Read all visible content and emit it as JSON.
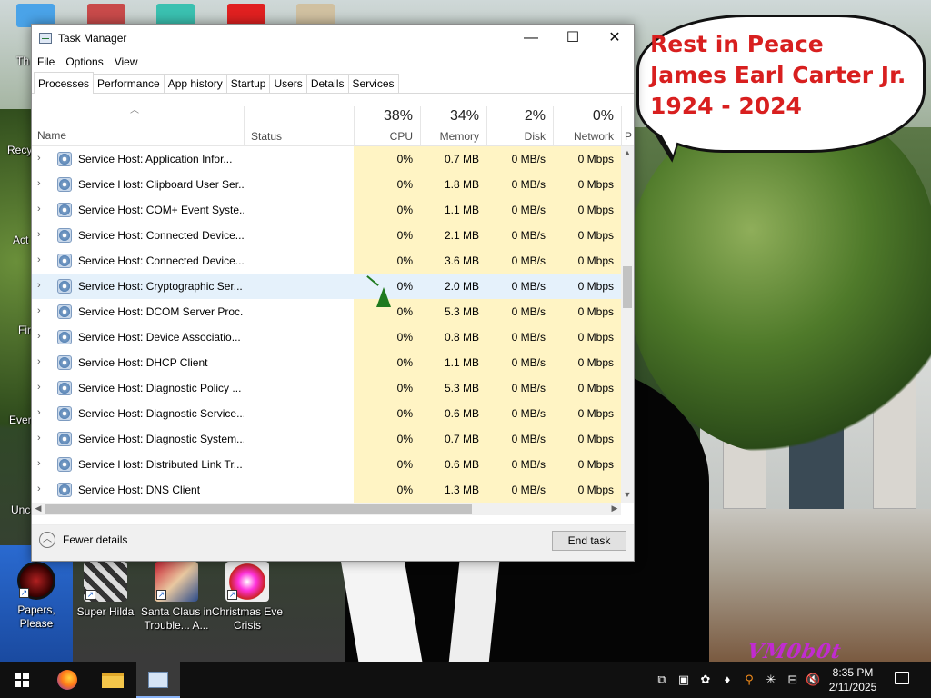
{
  "window": {
    "title": "Task Manager",
    "controls": {
      "minimize": "—",
      "maximize": "☐",
      "close": "✕"
    }
  },
  "menu": [
    "File",
    "Options",
    "View"
  ],
  "tabs": [
    "Processes",
    "Performance",
    "App history",
    "Startup",
    "Users",
    "Details",
    "Services"
  ],
  "columns": {
    "name": "Name",
    "status": "Status",
    "cpu": {
      "pct": "38%",
      "label": "CPU"
    },
    "memory": {
      "pct": "34%",
      "label": "Memory"
    },
    "disk": {
      "pct": "2%",
      "label": "Disk"
    },
    "network": {
      "pct": "0%",
      "label": "Network"
    },
    "power_cut": "P"
  },
  "processes": [
    {
      "name": "Service Host: Application Infor...",
      "cpu": "0%",
      "memory": "0.7 MB",
      "disk": "0 MB/s",
      "network": "0 Mbps"
    },
    {
      "name": "Service Host: Clipboard User Ser...",
      "cpu": "0%",
      "memory": "1.8 MB",
      "disk": "0 MB/s",
      "network": "0 Mbps"
    },
    {
      "name": "Service Host: COM+ Event Syste...",
      "cpu": "0%",
      "memory": "1.1 MB",
      "disk": "0 MB/s",
      "network": "0 Mbps"
    },
    {
      "name": "Service Host: Connected Device...",
      "cpu": "0%",
      "memory": "2.1 MB",
      "disk": "0 MB/s",
      "network": "0 Mbps"
    },
    {
      "name": "Service Host: Connected Device...",
      "cpu": "0%",
      "memory": "3.6 MB",
      "disk": "0 MB/s",
      "network": "0 Mbps"
    },
    {
      "name": "Service Host: Cryptographic Ser...",
      "cpu": "0%",
      "memory": "2.0 MB",
      "disk": "0 MB/s",
      "network": "0 Mbps"
    },
    {
      "name": "Service Host: DCOM Server Proc...",
      "cpu": "0%",
      "memory": "5.3 MB",
      "disk": "0 MB/s",
      "network": "0 Mbps"
    },
    {
      "name": "Service Host: Device Associatio...",
      "cpu": "0%",
      "memory": "0.8 MB",
      "disk": "0 MB/s",
      "network": "0 Mbps"
    },
    {
      "name": "Service Host: DHCP Client",
      "cpu": "0%",
      "memory": "1.1 MB",
      "disk": "0 MB/s",
      "network": "0 Mbps"
    },
    {
      "name": "Service Host: Diagnostic Policy ...",
      "cpu": "0%",
      "memory": "5.3 MB",
      "disk": "0 MB/s",
      "network": "0 Mbps"
    },
    {
      "name": "Service Host: Diagnostic Service...",
      "cpu": "0%",
      "memory": "0.6 MB",
      "disk": "0 MB/s",
      "network": "0 Mbps"
    },
    {
      "name": "Service Host: Diagnostic System...",
      "cpu": "0%",
      "memory": "0.7 MB",
      "disk": "0 MB/s",
      "network": "0 Mbps"
    },
    {
      "name": "Service Host: Distributed Link Tr...",
      "cpu": "0%",
      "memory": "0.6 MB",
      "disk": "0 MB/s",
      "network": "0 Mbps"
    },
    {
      "name": "Service Host: DNS Client",
      "cpu": "0%",
      "memory": "1.3 MB",
      "disk": "0 MB/s",
      "network": "0 Mbps"
    }
  ],
  "selected_row": 5,
  "footer": {
    "fewer_details": "Fewer details",
    "end_task": "End task"
  },
  "bubble": {
    "line1": "Rest in Peace",
    "line2": "James Earl Carter Jr.",
    "line3": "1924 - 2024"
  },
  "desktop_icons": [
    {
      "label1": "Papers, Please",
      "label2": ""
    },
    {
      "label1": "Super Hilda",
      "label2": ""
    },
    {
      "label1": "Santa Claus in",
      "label2": "Trouble... A..."
    },
    {
      "label1": "Christmas Eve",
      "label2": "Crisis"
    }
  ],
  "edge_labels": [
    "Th",
    "Recy",
    "Act",
    "Fir",
    "Ever",
    "Unc"
  ],
  "watermark": "VM0b0t",
  "taskbar": {
    "time": "8:35 PM",
    "date": "2/11/2025"
  },
  "colors": {
    "accent": "#0078d7",
    "cpu_bg": "#fff4c4",
    "bubble_text": "#d81f1f",
    "selection": "#e5f1fb"
  }
}
